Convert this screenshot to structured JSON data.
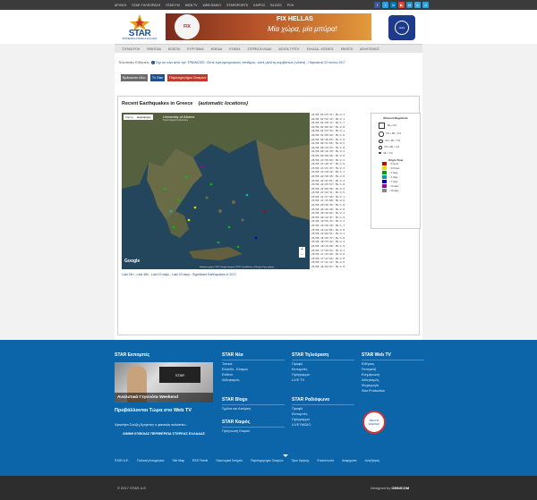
{
  "topbar": {
    "items": [
      "ΑΡΧΙΚΗ",
      "STAR ΤΗΛΕΟΡΑΣΗ",
      "STAR FM",
      "WEB TV",
      "WEB RADIO",
      "STARSPORTS",
      "ΚΑΙΡΟΣ",
      "BLOGS",
      "PCH"
    ]
  },
  "header": {
    "logo_text": "STAR",
    "logo_sub": "ΠΕΡΙΦΕΡΕΙΑ ΣΤΕΡΕΑΣ ΕΛΛΑΔΑΣ",
    "banner_brand": "FIX HELLAS",
    "banner_slogan": "Μία χώρα, μία μπύρα!",
    "banner_can": "FIX",
    "radio_logo": "radio"
  },
  "mainnav": [
    "ΤΟΠΙΚΑ ΡΟΗ",
    "ΦΘΙΩΤΙΔΑ",
    "ΒΟΙΩΤΙΑ",
    "ΕΥΡΥΤΑΝΙΑ",
    "ΦΩΚΙΔΑ",
    "ΕΥΒΟΙΑ",
    "ΣΤΕΡΕΑ ΕΛΛΑΔΑ",
    "ΔΕΛΤΙΑ ΤΥΠΟΥ",
    "ΕΛΛΑΔΑ - ΚΟΣΜΟΣ",
    "ΕΝΘΕΤΑ",
    "ΑΘΛΗΤΙΣΜΟΣ"
  ],
  "ticker": {
    "label": "Τελευταίες Ειδήσεις:",
    "text": "Όχι σε όλα από την ΤΡΑΙΝΟΣΕ. Ούτε εμπορευματικός σταθμός, ούτε μελέτη κομβιστών (video)",
    "date": "- Παρασκευή 23 Ιουνίου 2017"
  },
  "buttons": [
    {
      "label": "Βρίσκεστε εδώ:",
      "color": "#6b6b6b"
    },
    {
      "label": "Tv Star",
      "color": "#1d4f91"
    },
    {
      "label": "Παρατηρητήριο Σεισμών",
      "color": "#c0392b"
    }
  ],
  "panel": {
    "title": "Recent Earthquakes in Greece",
    "subtitle": "(automatic locations)",
    "rss": "RSS Feeds",
    "download_label": "Download:",
    "download_link": "Catalogue",
    "links": "Last 24h - Last 48h - Last 10 days - Last 20 days - Significant Earthquakes in 2017"
  },
  "map": {
    "type_map": "Χάρτης",
    "type_sat": "Δορυφόρος",
    "uoa_title": "University of Athens",
    "uoa_sub": "Seismological Laboratory",
    "google": "Google",
    "attribution": "Δεδομένα χάρτη ©2017 Google Imagery ©2017, TerraMetrics | 100 χλμ | Όροι χρήσης",
    "zoom_in": "+",
    "zoom_out": "−"
  },
  "quakes": [
    "24/06 03:25:37: ML:2.3",
    "24/06 02:52:12: ML:2.1",
    "24/06 02:28:17: ML:1.7",
    "24/06 02:00:22: ML:2.0",
    "24/06 01:53:54: ML:2.1",
    "24/06 01:09:44: ML:1.6",
    "24/06 00:48:03: ML:1.9",
    "24/06 00:31:05: ML:2.5",
    "24/06 00:19:33: ML:1.8",
    "24/06 00:16:39: ML:2.2",
    "24/06 00:09:26: ML:2.0",
    "23/06 23:55:04: ML:2.1",
    "23/06 23:40:17: ML:1.9",
    "23/06 23:21:43: ML:2.3",
    "23/06 23:10:12: ML:1.7",
    "23/06 22:58:45: ML:2.0",
    "23/06 22:41:01: ML:2.4",
    "23/06 22:25:57: ML:1.8",
    "23/06 22:09:30: ML:2.2",
    "23/06 21:52:11: ML:1.9",
    "23/06 21:37:49: ML:2.1",
    "23/06 21:15:08: ML:2.6",
    "23/06 20:58:36: ML:1.8",
    "23/06 20:44:20: ML:2.0",
    "23/06 20:30:02: ML:2.2",
    "23/06 20:12:47: ML:1.9",
    "23/06 19:55:33: ML:2.3",
    "23/06 19:40:18: ML:1.7",
    "23/06 19:22:05: ML:2.0",
    "23/06 19:04:51: ML:2.1",
    "23/06 18:49:37: ML:1.8",
    "23/06 18:33:22: ML:2.4",
    "23/06 18:16:09: ML:1.9",
    "23/06 17:59:54: ML:2.2",
    "23/06 17:43:40: ML:2.0",
    "23/06 17:27:26: ML:1.8",
    "23/06 17:11:12: ML:2.5",
    "23/06 16:54:57: ML:1.9"
  ],
  "legend": {
    "mag_title": "Moment Magnitude",
    "mags": [
      "ML ≥ 6.0",
      "5.0 ≤ ML < 6.0",
      "4.0 ≤ ML < 5.0",
      "3.0 ≤ ML < 4.0",
      "ML < 3.0"
    ],
    "time_title": "Origin Time",
    "times": [
      {
        "label": "< 6 hours",
        "color": "#cc0000"
      },
      {
        "label": "< 24 hours",
        "color": "#e0e000"
      },
      {
        "label": "< 2 days",
        "color": "#00a000"
      },
      {
        "label": "< 4 days",
        "color": "#00a0a0"
      },
      {
        "label": "< 7 days",
        "color": "#0000cc"
      },
      {
        "label": "< 10 days",
        "color": "#a000a0"
      },
      {
        "label": "< 20 days",
        "color": "#888888"
      }
    ]
  },
  "footer": {
    "promo_title": "STAR Εκπομπές",
    "promo_bar": "Αναλυτικά Γεγονότα Weekend",
    "promo_tv": "STAR",
    "play_title": "Προβάλλονται Τώρα στο Web TV",
    "news1": "Χρυσήτα Σούζη,Χρηστος ο φανικός καλύπτει...",
    "news2": "ΛΙΜΝΗ ΕΥΒΟΙΑΣ ΠΕΡΙΦΕΡΕΙΑ ΣΤΕΡΕΑΣ ΕΛΛΑΔΑΣ",
    "cols": [
      {
        "title": "STAR Νέα",
        "links": [
          "Τοπικά",
          "Ελλάδα - Κόσμος",
          "Ενθετα",
          "Αθλητισμός"
        ]
      },
      {
        "title": "STAR Blogs",
        "links": [
          "Σχόλια και Απόψεις"
        ]
      },
      {
        "title": "STAR Καιρός",
        "links": [
          "Πρόγνωση Καιρού"
        ]
      },
      {
        "title": "STAR Τηλεόραση",
        "links": [
          "Προφίλ",
          "Εκπομπές",
          "Πρόγραμμα",
          "LIVE TV"
        ]
      },
      {
        "title": "STAR Ραδιόφωνο",
        "links": [
          "Προφίλ",
          "Εκπομπές",
          "Πρόγραμμα",
          "LIVE RADIO"
        ]
      },
      {
        "title": "STAR Web TV",
        "links": [
          "Ειδήσεις",
          "Ρεπορτάζ",
          "Ενημέρωση",
          "Αθλητισμός",
          "Ψυχαγωγία",
          "Star Production"
        ]
      }
    ],
    "badge": "ΜΕΛΟΣ ΕΝΩΣΗΣ",
    "links": [
      "STAR Α.Ε.",
      "Πολιτική Απορρήτου",
      "Site Map",
      "RSS Feeds",
      "Οικονομικά Στοιχεία",
      "Παρατηρητήριο Σεισμών",
      "Όροι Χρήσης",
      "Επικοινωνία",
      "Διαφημιστε",
      "Αναζήτηση"
    ]
  },
  "bottom": {
    "copyright": "© 2017 STAR Α.Ε.",
    "designed_by": "Designed by",
    "designer": "OMNICOM"
  }
}
